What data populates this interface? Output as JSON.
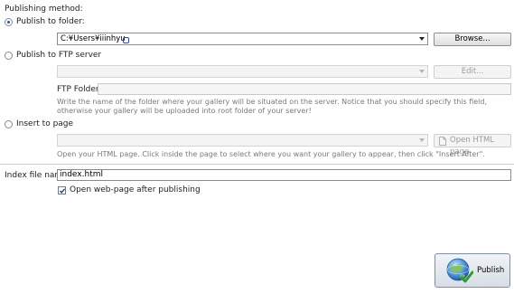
{
  "publishing_method_label": "Publishing method:",
  "options": {
    "folder": {
      "label": "Publish to folder:",
      "selected": true
    },
    "ftp": {
      "label": "Publish to FTP server",
      "selected": false
    },
    "insert": {
      "label": "Insert to page",
      "selected": false
    }
  },
  "folder": {
    "path_value": "C:¥Users¥iiinhyu",
    "browse_label": "Browse..."
  },
  "ftp": {
    "server_value": "",
    "edit_label": "Edit...",
    "folder_label": "FTP Folder",
    "folder_value": "",
    "note": "Write the name of the folder where your gallery will be situated on the server. Notice that you should specify this field, otherwise your gallery will be uploaded into root folder of your server!"
  },
  "insert": {
    "page_value": "",
    "open_label": "Open HTML page",
    "note": "Open your HTML page. Click inside the page to select where you want your gallery to appear, then click \"Insert After\"."
  },
  "index": {
    "label": "Index file name",
    "value": "index.html"
  },
  "open_after": {
    "label": "Open web-page after publishing",
    "checked": true
  },
  "publish_label": "Publish",
  "colors": {
    "accent": "#2a5db0",
    "disabled_text": "#9c9c9c",
    "note_text": "#7a7a7a"
  }
}
